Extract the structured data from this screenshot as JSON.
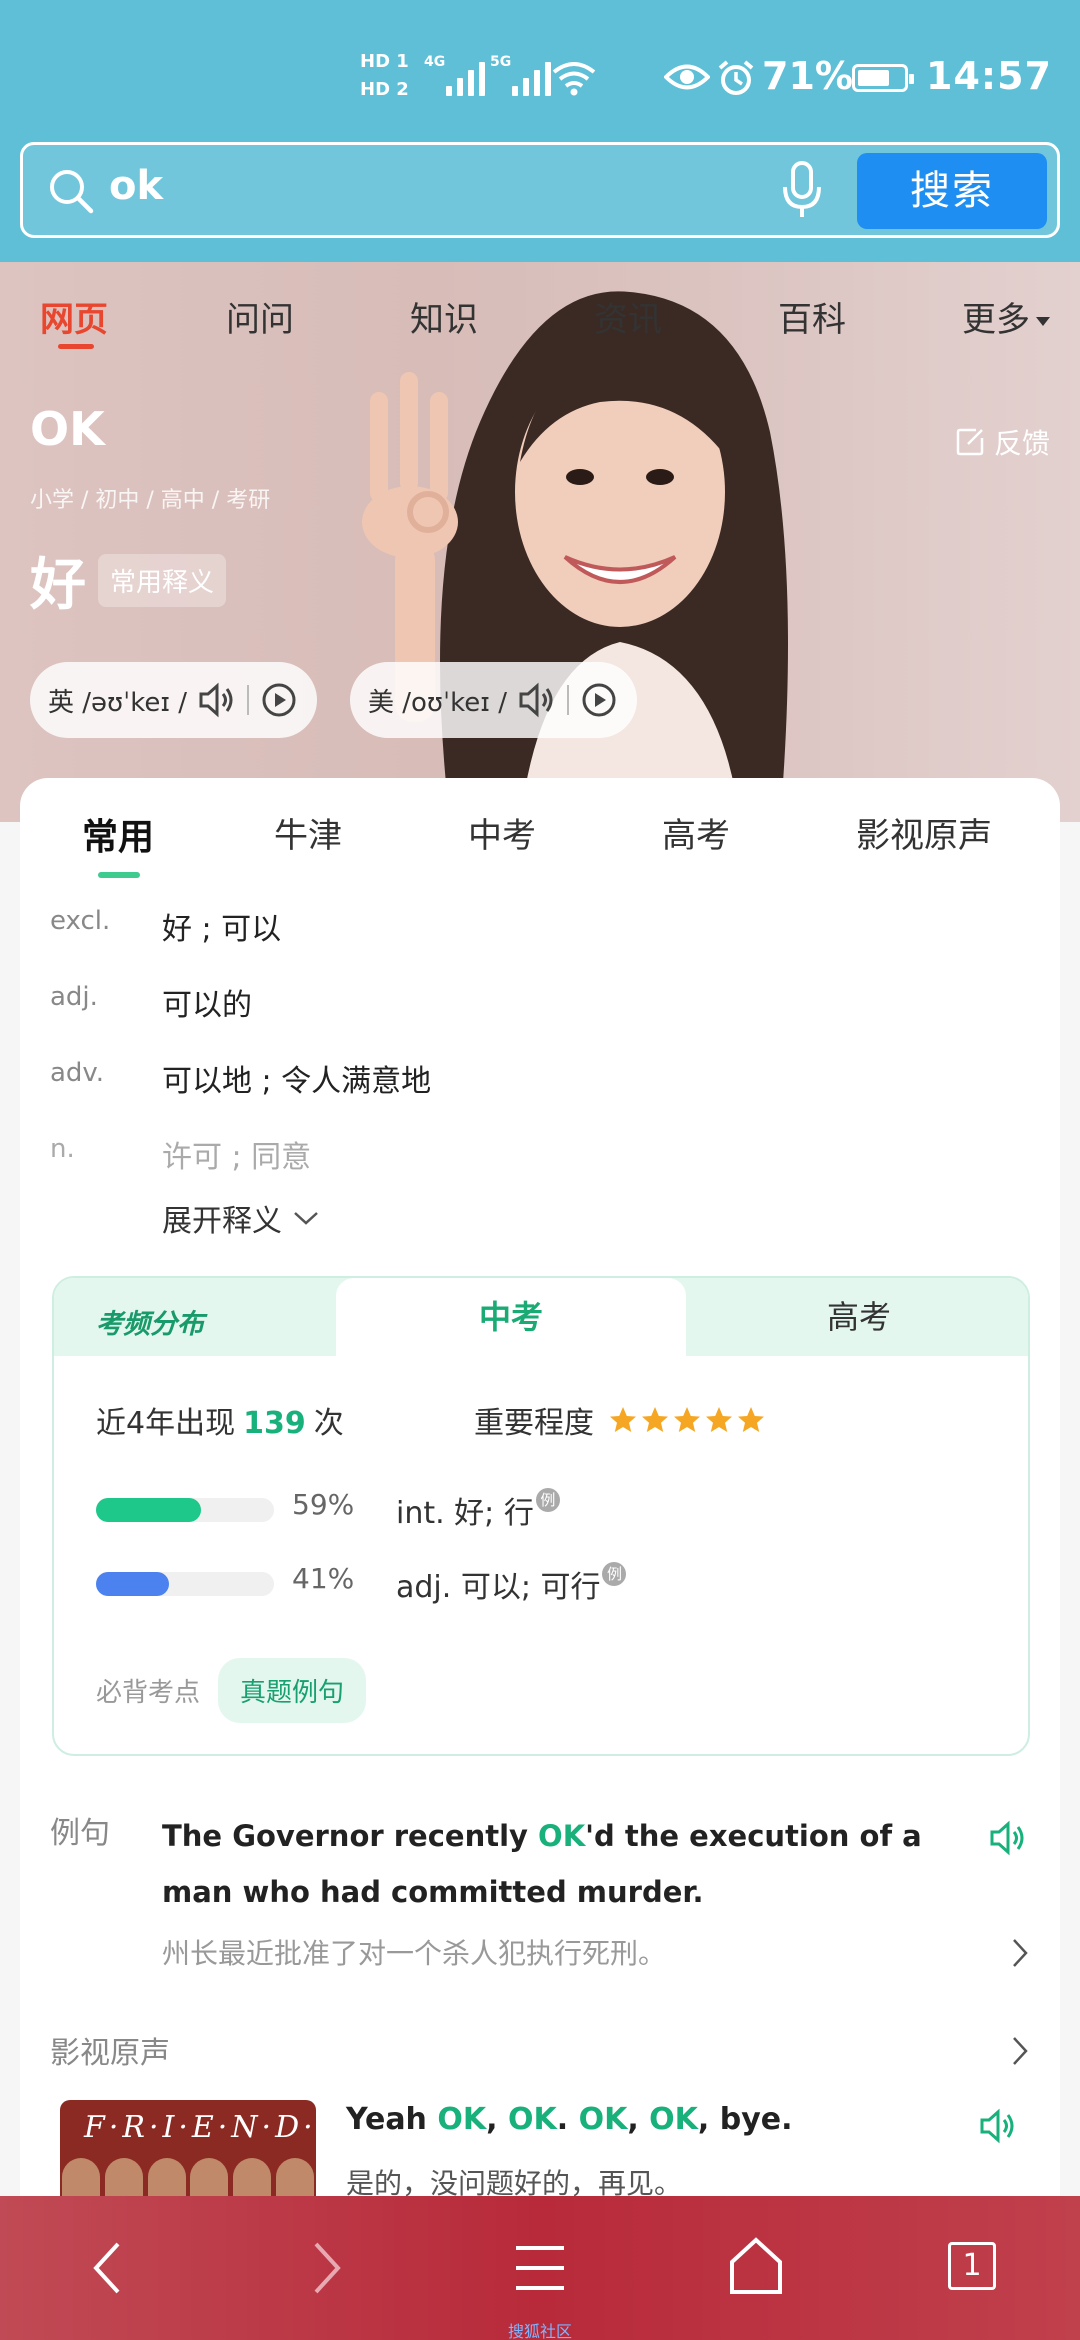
{
  "status": {
    "hd1": "HD 1",
    "hd2": "HD 2",
    "net1": "4G",
    "net2": "5G",
    "battery_pct": "71%",
    "battery_level": 0.71,
    "time": "14:57"
  },
  "search": {
    "query": "ok",
    "button": "搜索"
  },
  "nav_tabs": [
    "网页",
    "问问",
    "知识",
    "资讯",
    "百科",
    "更多"
  ],
  "hero": {
    "word": "OK",
    "feedback": "反馈",
    "levels": "小学 / 初中 / 高中 / 考研",
    "main_meaning": "好",
    "tag": "常用释义",
    "uk": "英 /əʊˈkeɪ /",
    "us": "美 /oʊˈkeɪ /"
  },
  "card_tabs": [
    "常用",
    "牛津",
    "中考",
    "高考",
    "影视原声"
  ],
  "definitions": [
    {
      "pos": "excl.",
      "meaning": "好 ; 可以"
    },
    {
      "pos": "adj.",
      "meaning": "可以的"
    },
    {
      "pos": "adv.",
      "meaning": "可以地 ; 令人满意地"
    },
    {
      "pos": "n.",
      "meaning": "许可 ; 同意"
    }
  ],
  "expand_label": "展开释义",
  "freq": {
    "title": "考频分布",
    "tab_active": "中考",
    "tab_other": "高考",
    "appear_prefix": "近4年出现",
    "count": "139",
    "appear_suffix": "次",
    "importance_label": "重要程度",
    "stars": 5,
    "rows": [
      {
        "pct": "59%",
        "value": 0.59,
        "sense": "int. 好; 行",
        "mark": "例",
        "color": "#1dc88a"
      },
      {
        "pct": "41%",
        "value": 0.41,
        "sense": "adj. 可以; 可行",
        "mark": "例",
        "color": "#4b82f0"
      }
    ],
    "must_label": "必背考点",
    "pill": "真题例句"
  },
  "example": {
    "label": "例句",
    "en_before": "The Governor recently ",
    "en_hl": "OK",
    "en_after": "'d the execution of a man who had committed murder.",
    "zh": "州长最近批准了对一个杀人犯执行死刑。"
  },
  "film": {
    "label": "影视原声",
    "thumb_title": "F·R·I·E·N·D·S",
    "en_parts": [
      {
        "t": "Yeah ",
        "hl": false
      },
      {
        "t": "OK",
        "hl": true
      },
      {
        "t": ", ",
        "hl": false
      },
      {
        "t": "OK",
        "hl": true
      },
      {
        "t": ". ",
        "hl": false
      },
      {
        "t": "OK",
        "hl": true
      },
      {
        "t": ", ",
        "hl": false
      },
      {
        "t": "OK",
        "hl": true
      },
      {
        "t": ", bye.",
        "hl": false
      }
    ],
    "zh": "是的，没问题好的，再见。"
  },
  "bottom": {
    "tab_count": "1",
    "watermark": "搜狐社区"
  }
}
